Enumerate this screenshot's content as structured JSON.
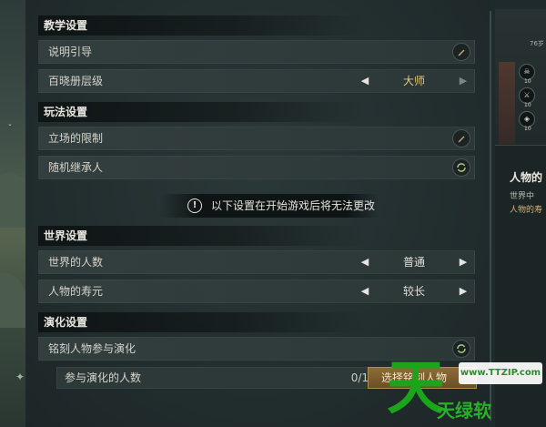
{
  "sections": {
    "tutorial": {
      "title": "教学设置",
      "rows": [
        {
          "label": "说明引导"
        },
        {
          "label": "百晓册层级",
          "value": "大师"
        }
      ]
    },
    "gameplay": {
      "title": "玩法设置",
      "rows": [
        {
          "label": "立场的限制"
        },
        {
          "label": "随机继承人"
        }
      ]
    },
    "notice": "以下设置在开始游戏后将无法更改",
    "world": {
      "title": "世界设置",
      "rows": [
        {
          "label": "世界的人数",
          "value": "普通"
        },
        {
          "label": "人物的寿元",
          "value": "较长"
        }
      ]
    },
    "evolution": {
      "title": "演化设置",
      "rows": [
        {
          "label": "铭刻人物参与演化"
        }
      ],
      "count_label": "参与演化的人数",
      "count_value": "0/1",
      "select_button": "选择铭刻人物"
    }
  },
  "right_panel": {
    "age": "76岁",
    "stats": [
      "10",
      "10",
      "10"
    ],
    "name": "人物的",
    "line1": "世界中",
    "line2": "人物的寿"
  },
  "watermark": {
    "url": "www.TTZIP.com",
    "big_glyph": "天",
    "text": "天绿软"
  },
  "colors": {
    "accent_gold": "#e2c77f",
    "button_bronze": "#8d6c36",
    "watermark_green": "#1aa51a"
  }
}
